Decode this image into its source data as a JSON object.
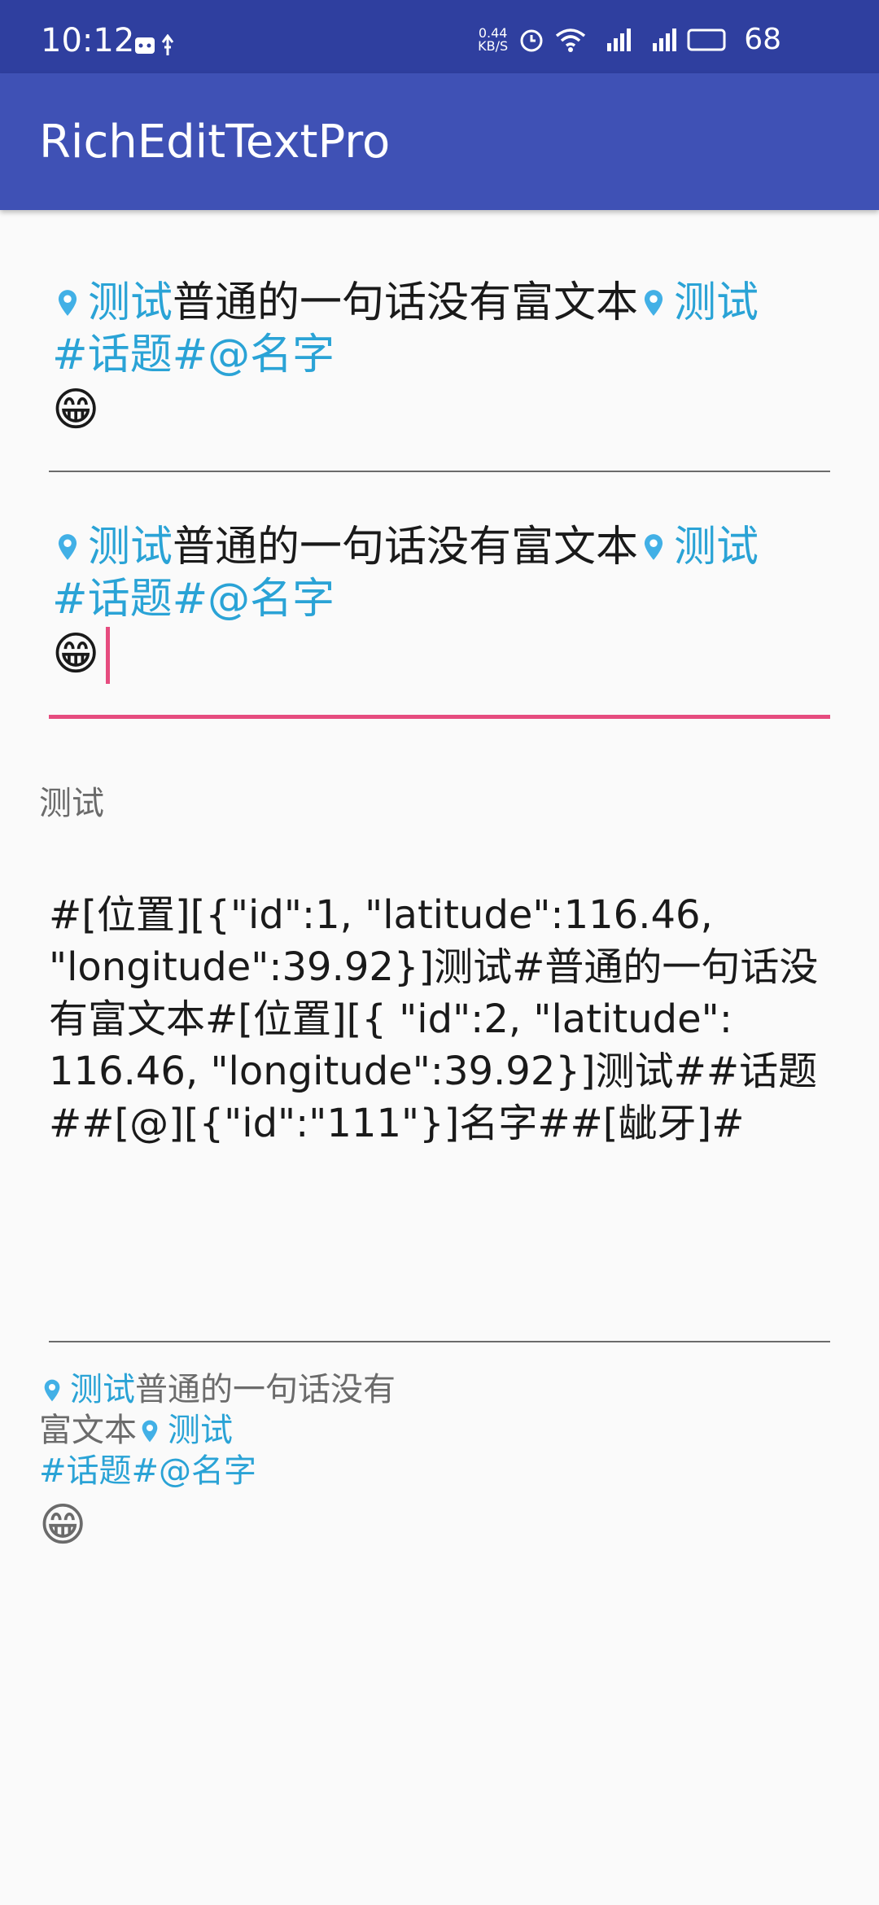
{
  "status_bar": {
    "time": "10:12",
    "speed_line1": "0.44",
    "speed_line2": "KB/S",
    "battery": "68"
  },
  "app_bar": {
    "title": "RichEditTextPro"
  },
  "rich_text": {
    "location_label": "测试",
    "plain_sentence": "普通的一句话没有富文本",
    "topic": "#话题#",
    "mention": "@名字",
    "emoji": "😁"
  },
  "label_above_raw": "测试",
  "raw_text": "#[位置][{\"id\":1, \"latitude\":116.46, \"longitude\":39.92}]测试#普通的一句话没有富文本#[位置][{ \"id\":2, \"latitude\": 116.46, \"longitude\":39.92}]测试##话题##[@][{\"id\":\"111\"}]名字##[龇牙]#",
  "bottom_rich": {
    "line1_location": "测试",
    "line1_text": "普通的一句话没有",
    "line2_text": "富文本",
    "line2_location": "测试",
    "line3_topic": "#话题#",
    "line3_mention": "@名字",
    "emoji": "😁"
  }
}
